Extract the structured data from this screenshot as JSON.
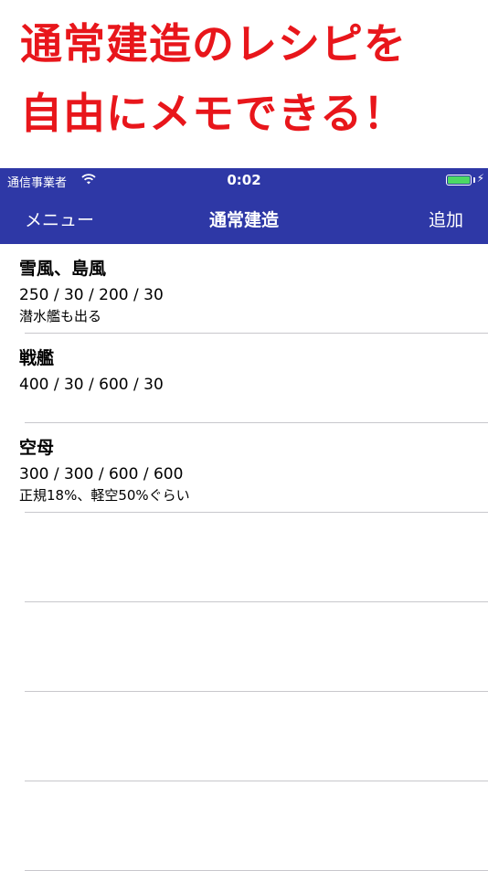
{
  "promo": {
    "line1": "通常建造のレシピを",
    "line2": "自由にメモできる！",
    "color": "#e8161b"
  },
  "status_bar": {
    "carrier": "通信事業者",
    "time": "0:02",
    "icons": [
      "wifi-icon",
      "battery-icon",
      "charging-bolt-icon"
    ],
    "battery_color": "#4cd964"
  },
  "nav_bar": {
    "left_label": "メニュー",
    "title": "通常建造",
    "right_label": "追加",
    "background": "#2e38a6"
  },
  "recipes": [
    {
      "title": "雪風、島風",
      "values": "250 / 30 / 200 / 30",
      "note": "潜水艦も出る"
    },
    {
      "title": "戦艦",
      "values": "400 / 30 / 600 / 30",
      "note": ""
    },
    {
      "title": "空母",
      "values": "300 / 300 / 600 / 600",
      "note": "正規18%、軽空50%ぐらい"
    },
    {
      "title": "",
      "values": "",
      "note": ""
    },
    {
      "title": "",
      "values": "",
      "note": ""
    },
    {
      "title": "",
      "values": "",
      "note": ""
    },
    {
      "title": "",
      "values": "",
      "note": ""
    }
  ]
}
